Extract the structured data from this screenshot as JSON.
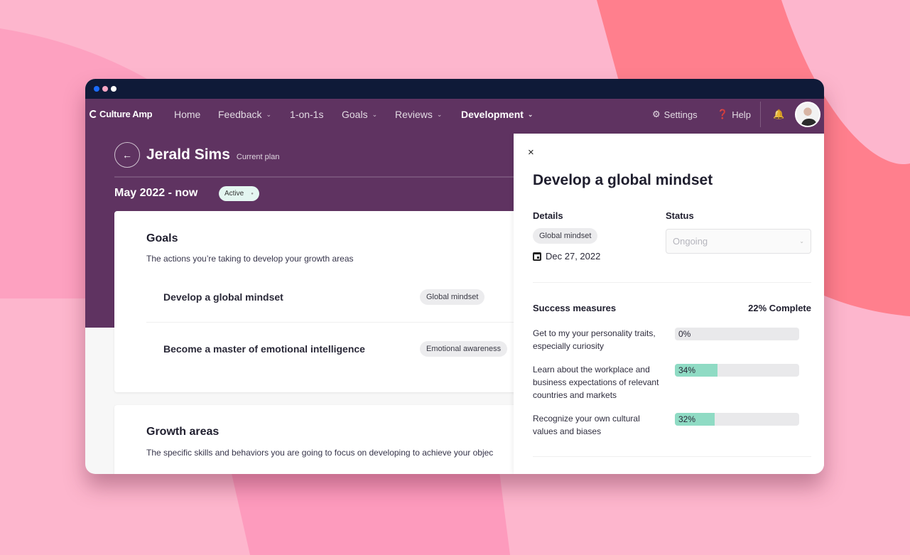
{
  "colors": {
    "background": "#fdb6cd",
    "titlebar": "#0f1a38",
    "nav_purple": "#5f3361",
    "progress_fill": "#8fdbc4",
    "active_pill": "#e4f6f1"
  },
  "window": {
    "dots": [
      "blue",
      "pink",
      "white"
    ]
  },
  "navbar": {
    "logo": "Culture Amp",
    "items": [
      {
        "label": "Home",
        "has_dropdown": false
      },
      {
        "label": "Feedback",
        "has_dropdown": true
      },
      {
        "label": "1-on-1s",
        "has_dropdown": false
      },
      {
        "label": "Goals",
        "has_dropdown": true
      },
      {
        "label": "Reviews",
        "has_dropdown": true
      },
      {
        "label": "Development",
        "has_dropdown": true,
        "active": true
      }
    ],
    "settings_label": "Settings",
    "help_label": "Help",
    "notifications_icon": "bell-icon",
    "avatar_alt": "User avatar"
  },
  "plan": {
    "name": "Jerald Sims",
    "subtitle": "Current plan",
    "period": "May 2022 - now",
    "status": "Active"
  },
  "goals_card": {
    "title": "Goals",
    "description": "The actions you’re taking to develop your growth areas",
    "goals": [
      {
        "name": "Develop a global mindset",
        "tag": "Global mindset"
      },
      {
        "name": "Become a master of emotional intelligence",
        "tag": "Emotional awareness"
      }
    ]
  },
  "growth_card": {
    "title": "Growth areas",
    "description": "The specific skills and behaviors you are going to focus on developing to achieve your objec"
  },
  "drawer": {
    "close_icon": "×",
    "title": "Develop a global mindset",
    "details_label": "Details",
    "details_tag": "Global mindset",
    "due_date": "Dec 27, 2022",
    "status_label": "Status",
    "status_value": "Ongoing",
    "success_label": "Success measures",
    "complete_label": "22% Complete",
    "measures": [
      {
        "text": "Get to my your personality traits, especially curiosity",
        "percent": 0,
        "label": "0%"
      },
      {
        "text": "Learn about the workplace and business expectations of relevant countries and markets",
        "percent": 34,
        "label": "34%"
      },
      {
        "text": "Recognize your own cultural values and biases",
        "percent": 32,
        "label": "32%"
      }
    ]
  }
}
